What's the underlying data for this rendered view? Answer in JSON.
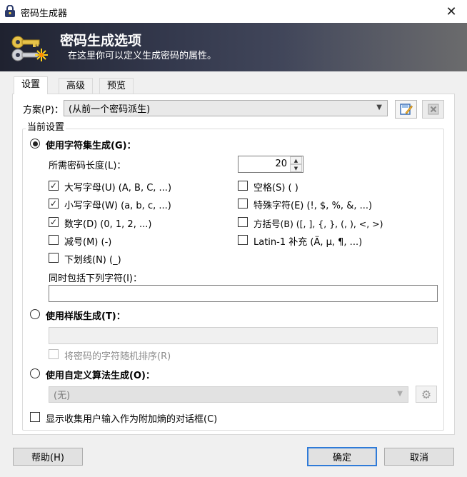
{
  "window": {
    "title": "密码生成器",
    "close_glyph": "✕"
  },
  "banner": {
    "title": "密码生成选项",
    "subtitle": "在这里你可以定义生成密码的属性。"
  },
  "tabs": [
    {
      "label": "设置",
      "active": true
    },
    {
      "label": "高级"
    },
    {
      "label": "预览"
    }
  ],
  "profile": {
    "label": "方案(P)：",
    "value": "(从前一个密码派生)",
    "save_icon": "save-profile-icon",
    "delete_icon": "delete-profile-icon"
  },
  "current_settings": {
    "title": "当前设置",
    "charset_mode": {
      "label": "使用字符集生成(G)：",
      "length_label": "所需密码长度(L)：",
      "length_value": "20",
      "options": [
        {
          "label": "大写字母(U)  (A, B, C, ...)",
          "checked": true
        },
        {
          "label": "空格(S)  ( )",
          "checked": false
        },
        {
          "label": "小写字母(W)  (a, b, c, ...)",
          "checked": true
        },
        {
          "label": "特殊字符(E)  (!, $, %, &, ...)",
          "checked": false
        },
        {
          "label": "数字(D)  (0, 1, 2, ...)",
          "checked": true
        },
        {
          "label": "方括号(B)  ([, ], {, }, (, ), <, >)",
          "checked": false
        },
        {
          "label": "减号(M)  (-)",
          "checked": false
        },
        {
          "label": "Latin-1 补充  (Ä, µ, ¶, ...)",
          "checked": false
        },
        {
          "label": "下划线(N)  (_)",
          "checked": false
        }
      ],
      "include_label": "同时包括下列字符(I)：",
      "include_value": ""
    },
    "pattern_mode": {
      "label": "使用样版生成(T)：",
      "pattern_value": "",
      "shuffle_label": "将密码的字符随机排序(R)"
    },
    "custom_mode": {
      "label": "使用自定义算法生成(O)：",
      "algorithm_value": "(无)"
    }
  },
  "show_entropy_label": "显示收集用户输入作为附加熵的对话框(C)",
  "buttons": {
    "help": "帮助(H)",
    "ok": "确定",
    "cancel": "取消"
  }
}
